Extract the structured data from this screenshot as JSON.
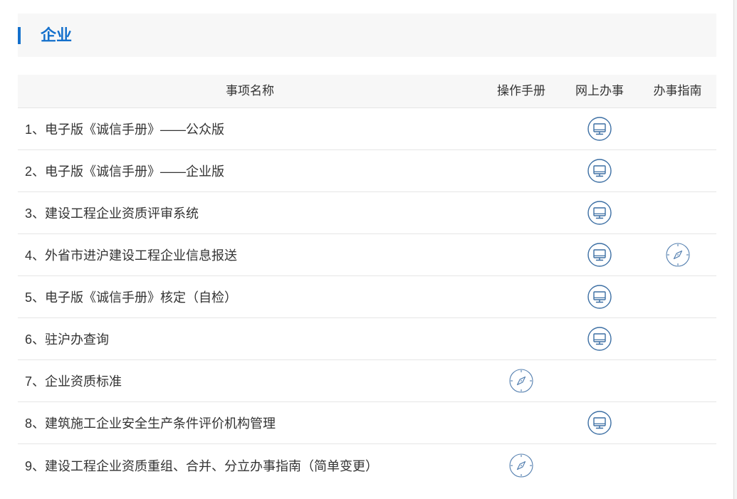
{
  "section": {
    "title": "企业"
  },
  "table": {
    "columns": {
      "name": "事项名称",
      "manual": "操作手册",
      "online": "网上办事",
      "guide": "办事指南"
    },
    "rows": [
      {
        "name": "1、电子版《诚信手册》——公众版",
        "manual": null,
        "online": "monitor-icon",
        "guide": null
      },
      {
        "name": "2、电子版《诚信手册》——企业版",
        "manual": null,
        "online": "monitor-icon",
        "guide": null
      },
      {
        "name": "3、建设工程企业资质评审系统",
        "manual": null,
        "online": "monitor-icon",
        "guide": null
      },
      {
        "name": "4、外省市进沪建设工程企业信息报送",
        "manual": null,
        "online": "monitor-icon",
        "guide": "compass-icon"
      },
      {
        "name": "5、电子版《诚信手册》核定（自检）",
        "manual": null,
        "online": "monitor-icon",
        "guide": null
      },
      {
        "name": "6、驻沪办查询",
        "manual": null,
        "online": "monitor-icon",
        "guide": null
      },
      {
        "name": "7、企业资质标准",
        "manual": "compass-icon",
        "online": null,
        "guide": null
      },
      {
        "name": "8、建筑施工企业安全生产条件评价机构管理",
        "manual": null,
        "online": "monitor-icon",
        "guide": null
      },
      {
        "name": "9、建设工程企业资质重组、合并、分立办事指南（简单变更）",
        "manual": "compass-icon",
        "online": null,
        "guide": null
      }
    ]
  },
  "colors": {
    "accent": "#1470cc",
    "monitor_icon": "#3b6ea3",
    "compass_icon": "#5580b0",
    "header_bg": "#f7f7f7",
    "text": "#333333",
    "divider": "#e6e6e6"
  }
}
